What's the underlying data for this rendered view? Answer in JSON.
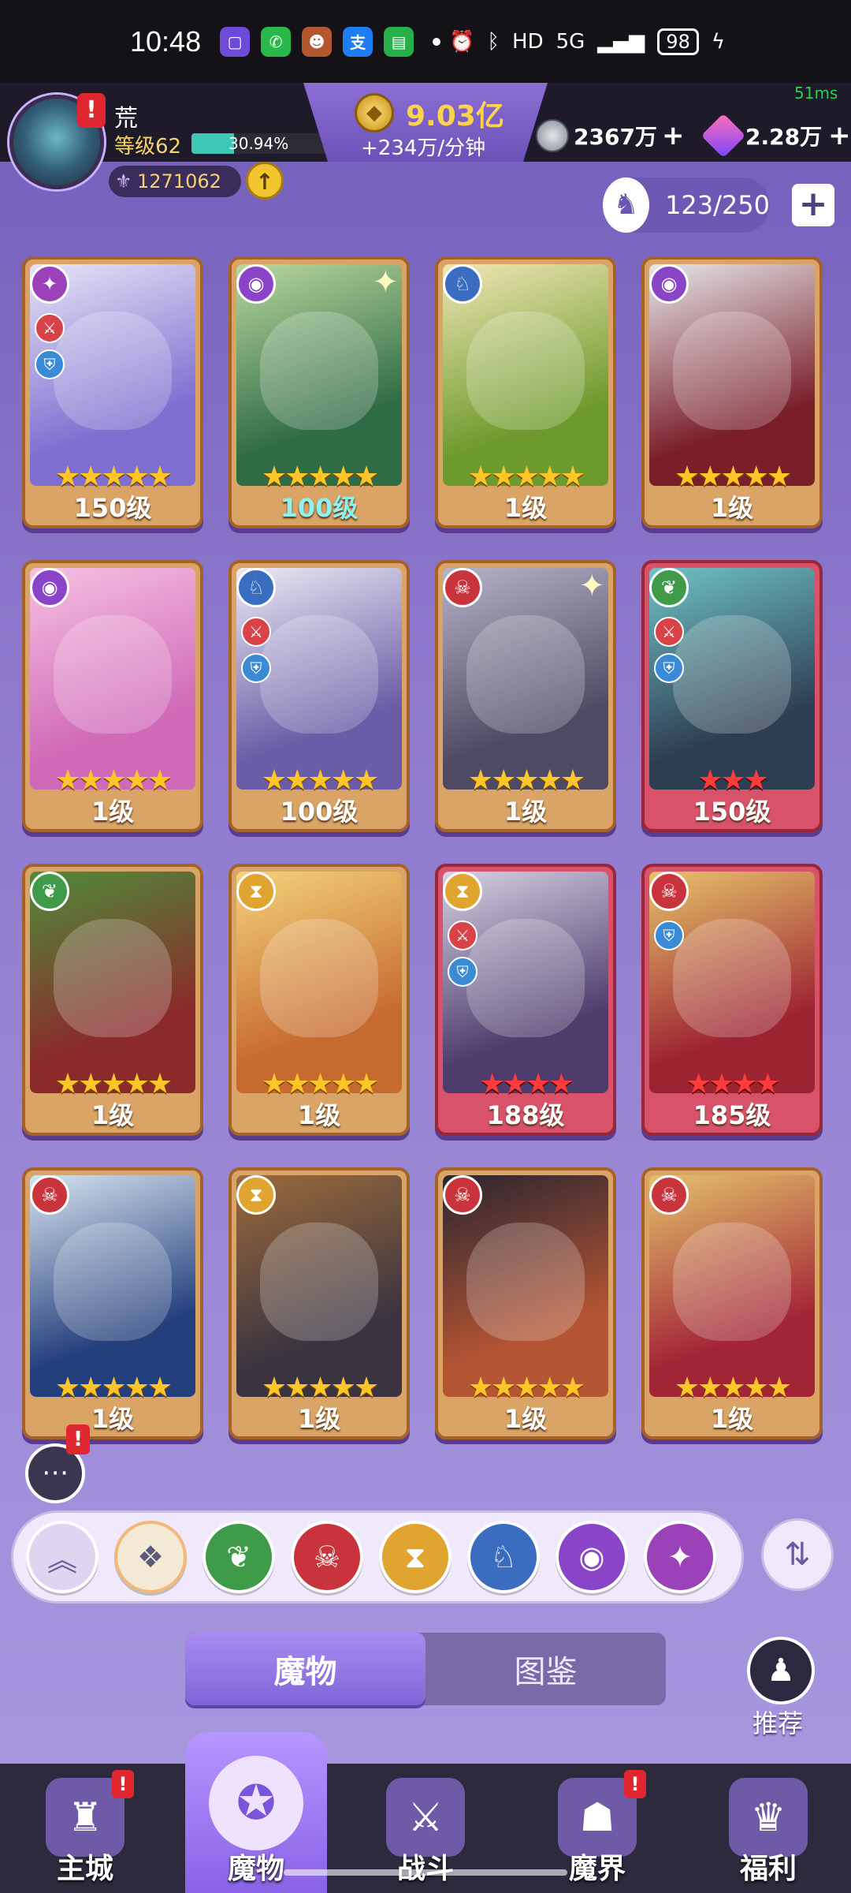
{
  "status_bar": {
    "time": "10:48",
    "network": "HD",
    "signal": "5G",
    "battery": "98"
  },
  "player": {
    "name": "荒",
    "level_label": "等级62",
    "exp_percent": "30.94%",
    "exp_fraction": 0.3094,
    "power": "1271062",
    "alert_badge": "!"
  },
  "resources": {
    "gold": "9.03亿",
    "gold_rate": "+234万/分钟",
    "silver": "2367万",
    "crystal": "2.28万",
    "plus": "+"
  },
  "ping": "51ms",
  "capacity": {
    "text": "123/250",
    "plus": "+"
  },
  "heroes": [
    {
      "level": "150级",
      "stars": 5,
      "star_color": "gold",
      "frame": "gold",
      "faction": "void",
      "roles": [
        "atk",
        "def"
      ],
      "art_colors": [
        "#7d6ecf",
        "#e7e5f7"
      ]
    },
    {
      "level": "100级",
      "stars": 5,
      "star_color": "gold",
      "frame": "gold",
      "faction": "eye",
      "roles": [],
      "art_colors": [
        "#2f6b44",
        "#b9d89e"
      ],
      "level_color": "cyan",
      "sparkle": true
    },
    {
      "level": "1级",
      "stars": 5,
      "star_color": "gold",
      "frame": "gold",
      "faction": "dragon",
      "roles": [],
      "art_colors": [
        "#6d9a2d",
        "#f0e6b5"
      ]
    },
    {
      "level": "1级",
      "stars": 5,
      "star_color": "gold",
      "frame": "gold",
      "faction": "eye",
      "roles": [],
      "art_colors": [
        "#7a1f2a",
        "#e6e6ea"
      ]
    },
    {
      "level": "1级",
      "stars": 5,
      "star_color": "gold",
      "frame": "gold",
      "faction": "eye",
      "roles": [],
      "art_colors": [
        "#d06ab8",
        "#f6c0e2"
      ]
    },
    {
      "level": "100级",
      "stars": 5,
      "star_color": "gold",
      "frame": "gold",
      "faction": "dragon",
      "roles": [
        "atk",
        "def"
      ],
      "art_colors": [
        "#6a5ca6",
        "#eceaf4"
      ]
    },
    {
      "level": "1级",
      "stars": 5,
      "star_color": "gold",
      "frame": "gold",
      "faction": "demon",
      "roles": [],
      "art_colors": [
        "#4e4a63",
        "#b7b3c9"
      ],
      "sparkle": true
    },
    {
      "level": "150级",
      "stars": 3,
      "star_color": "red",
      "frame": "red",
      "faction": "nature",
      "roles": [
        "atk",
        "def"
      ],
      "art_colors": [
        "#2d3e52",
        "#6fc2c6"
      ]
    },
    {
      "level": "1级",
      "stars": 5,
      "star_color": "gold",
      "frame": "gold",
      "faction": "nature",
      "roles": [],
      "art_colors": [
        "#8b2a2a",
        "#4f8b3a"
      ]
    },
    {
      "level": "1级",
      "stars": 5,
      "star_color": "gold",
      "frame": "gold",
      "faction": "time",
      "roles": [],
      "art_colors": [
        "#c76a2f",
        "#f3d27a"
      ]
    },
    {
      "level": "188级",
      "stars": 4,
      "star_color": "red",
      "frame": "red",
      "faction": "time",
      "roles": [
        "atk",
        "def"
      ],
      "art_colors": [
        "#4e3c6d",
        "#d6d2e3"
      ]
    },
    {
      "level": "185级",
      "stars": 4,
      "star_color": "red",
      "frame": "red",
      "faction": "demon",
      "roles": [
        "def"
      ],
      "art_colors": [
        "#9c2431",
        "#e7c36b"
      ]
    },
    {
      "level": "1级",
      "stars": 5,
      "star_color": "gold",
      "frame": "gold",
      "faction": "demon",
      "roles": [],
      "art_colors": [
        "#233f7c",
        "#d6e3ef"
      ]
    },
    {
      "level": "1级",
      "stars": 5,
      "star_color": "gold",
      "frame": "gold",
      "faction": "time",
      "roles": [],
      "art_colors": [
        "#3b3440",
        "#9b6a3b"
      ]
    },
    {
      "level": "1级",
      "stars": 5,
      "star_color": "gold",
      "frame": "gold",
      "faction": "demon",
      "roles": [],
      "art_colors": [
        "#b45533",
        "#2b2530"
      ]
    },
    {
      "level": "1级",
      "stars": 5,
      "star_color": "gold",
      "frame": "gold",
      "faction": "demon",
      "roles": [],
      "art_colors": [
        "#a22536",
        "#e4c16c"
      ]
    }
  ],
  "filters": [
    {
      "name": "all",
      "icon": "diamond-grid-icon",
      "color": "#f4e9d4"
    },
    {
      "name": "nature",
      "icon": "leaf-icon",
      "color": "#3f9a4a"
    },
    {
      "name": "demon",
      "icon": "demon-mask-icon",
      "color": "#c9333c"
    },
    {
      "name": "time",
      "icon": "hourglass-icon",
      "color": "#e0a530"
    },
    {
      "name": "dragon",
      "icon": "dragon-icon",
      "color": "#3a6cc0"
    },
    {
      "name": "eye",
      "icon": "eye-icon",
      "color": "#8a44c8"
    },
    {
      "name": "void",
      "icon": "void-swirl-icon",
      "color": "#9b42b8"
    }
  ],
  "tabs": [
    {
      "label": "魔物",
      "active": true
    },
    {
      "label": "图鉴",
      "active": false
    }
  ],
  "recommend": {
    "label": "推荐"
  },
  "bottom_nav": [
    {
      "label": "主城",
      "icon": "castle-icon",
      "badge": "!",
      "active": false
    },
    {
      "label": "魔物",
      "icon": "flame-orb-icon",
      "badge": "",
      "active": true
    },
    {
      "label": "战斗",
      "icon": "sword-shield-icon",
      "badge": "",
      "active": false
    },
    {
      "label": "魔界",
      "icon": "demon-realm-icon",
      "badge": "!",
      "active": false
    },
    {
      "label": "福利",
      "icon": "treasure-chest-icon",
      "badge": "",
      "active": false
    }
  ]
}
